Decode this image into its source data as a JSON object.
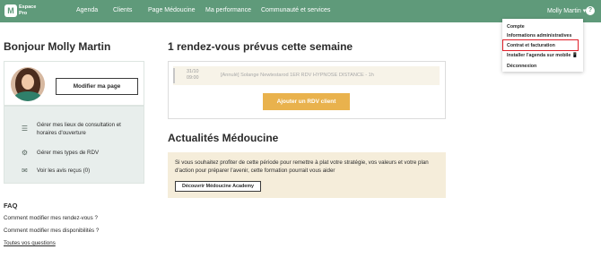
{
  "header": {
    "logo_letter": "M",
    "logo_line1": "Espace",
    "logo_line2": "Pro",
    "nav": [
      "Agenda",
      "Clients",
      "Page Médoucine",
      "Ma performance",
      "Communauté et services"
    ],
    "user_name": "Molly Martin",
    "user_caret": "▾",
    "help": "?"
  },
  "dropdown": {
    "items": [
      "Compte",
      "Informations administratives",
      "Contrat et facturation",
      "Installer l'agenda sur mobile 📱",
      "Déconnexion"
    ],
    "highlighted": "Contrat et facturation"
  },
  "sidebar": {
    "greeting": "Bonjour Molly Martin",
    "edit_page_button": "Modifier ma page",
    "menu": [
      {
        "icon": "list-icon",
        "glyph": "☰",
        "label_line1": "Gérer mes lieux de consultation et",
        "label_line2": "horaires d'ouverture"
      },
      {
        "icon": "settings-icon",
        "glyph": "⚙",
        "label_line1": "Gérer mes types de RDV",
        "label_line2": ""
      },
      {
        "icon": "comment-icon",
        "glyph": "✉",
        "label_line1": "Voir les avis reçus (0)",
        "label_line2": ""
      }
    ],
    "faq_title": "FAQ",
    "faq_links": [
      "Comment modifier mes rendez-vous ?",
      "Comment modifier mes disponibilités ?",
      "Toutes vos questions"
    ]
  },
  "main": {
    "appointments_title": "1 rendez-vous prévus cette semaine",
    "appointment": {
      "date": "31/10",
      "time": "09:00",
      "description": "[Annulé] Solange Newtestarod  1ER RDV HYPNOSE DISTANCE - 1h"
    },
    "add_button": "Ajouter un RDV client",
    "news_title": "Actualités Médoucine",
    "news_text": "Si vous souhaitez profiter de cette période pour remettre à plat votre stratégie, vos valeurs et votre plan d'action pour préparer l'avenir, cette formation pourrait vous aider",
    "news_button": "Découvrir Médoucine Academy"
  },
  "colors": {
    "nav_bg": "#5f9a7a",
    "accent_yellow": "#e9b24d",
    "highlight_red": "#e0202a",
    "news_bg": "#f5edda",
    "sidebar_menu_bg": "#e8eeec"
  }
}
